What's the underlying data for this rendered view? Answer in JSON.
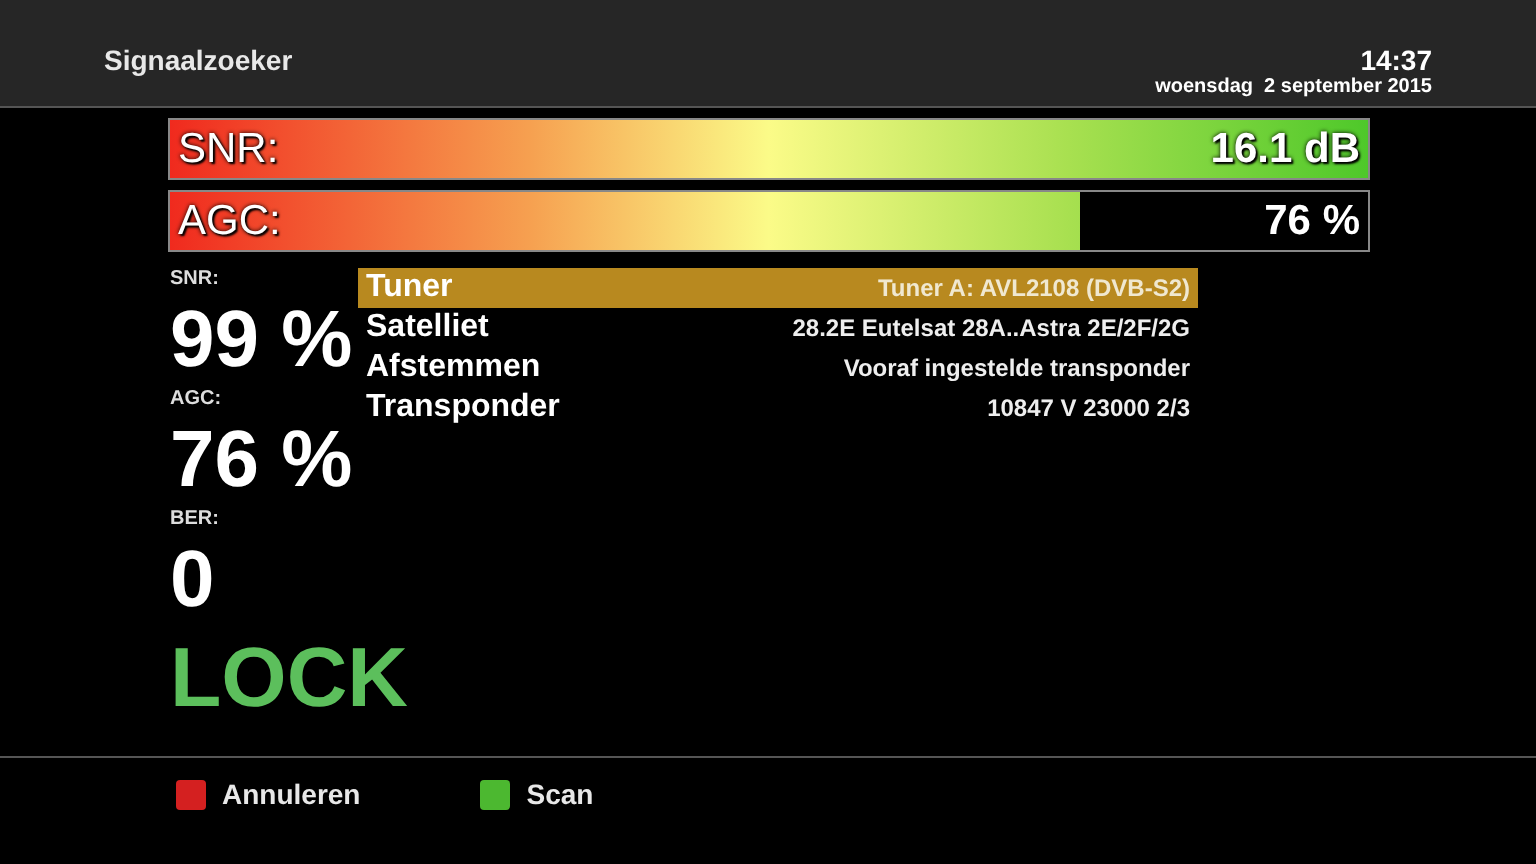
{
  "header": {
    "title": "Signaalzoeker",
    "time": "14:37",
    "date": "woensdag  2 september 2015"
  },
  "meters": [
    {
      "label": "SNR:",
      "reading": "16.1 dB",
      "level": 1.0
    },
    {
      "label": "AGC:",
      "reading": "76 %",
      "level": 0.76
    }
  ],
  "stats": [
    {
      "label": "SNR:",
      "value": "99 %"
    },
    {
      "label": "AGC:",
      "value": "76 %"
    },
    {
      "label": "BER:",
      "value": "0"
    }
  ],
  "lock": {
    "text": "LOCK",
    "locked": true
  },
  "info_rows": [
    {
      "label": "Tuner",
      "value": "Tuner A: AVL2108 (DVB-S2)",
      "selected": true
    },
    {
      "label": "Satelliet",
      "value": "28.2E Eutelsat 28A..Astra 2E/2F/2G",
      "selected": false
    },
    {
      "label": "Afstemmen",
      "value": "Vooraf ingestelde transponder",
      "selected": false
    },
    {
      "label": "Transponder",
      "value": "10847 V 23000 2/3",
      "selected": false
    }
  ],
  "footer_buttons": [
    {
      "label": "Annuleren",
      "color": "#d42020"
    },
    {
      "label": "Scan",
      "color": "#4cb830"
    }
  ]
}
